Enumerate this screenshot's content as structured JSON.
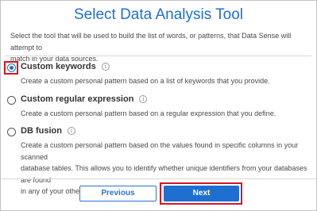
{
  "dialog": {
    "title": "Select Data Analysis Tool",
    "intro_line1": "Select the tool that will be used to build the list of words, or patterns, that Data Sense will attempt to",
    "intro_line2": "match in your data sources."
  },
  "options": [
    {
      "label": "Custom keywords",
      "selected": true,
      "info_icon": "info-icon",
      "desc_lines": [
        "Create a custom personal pattern based on a list of keywords that you provide."
      ]
    },
    {
      "label": "Custom regular expression",
      "selected": false,
      "info_icon": "info-icon",
      "desc_lines": [
        "Create a custom personal pattern based on a regular expression that you define."
      ]
    },
    {
      "label": "DB fusion",
      "selected": false,
      "info_icon": "info-icon",
      "desc_lines": [
        "Create a custom personal pattern based on the values found in specific columns in your scanned",
        "database tables. This allows you to identify whether unique identifiers from your databases are found",
        "in any of your other data sources."
      ]
    }
  ],
  "buttons": {
    "previous": "Previous",
    "next": "Next"
  },
  "colors": {
    "accent": "#1f6fd1",
    "highlight": "#d7161e"
  }
}
